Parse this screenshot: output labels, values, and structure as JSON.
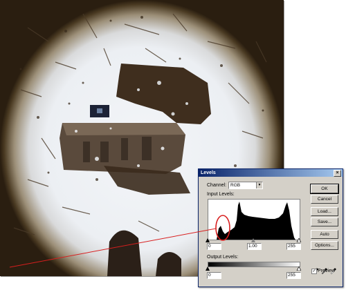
{
  "photo": {
    "description_icon": "snowy-ground-photo"
  },
  "dialog": {
    "title": "Levels",
    "close_glyph": "×",
    "channel_label": "Channel:",
    "channel_value": "RGB",
    "input_levels_label": "Input Levels:",
    "input_black": "0",
    "input_gamma": "1.00",
    "input_white": "255",
    "output_levels_label": "Output Levels:",
    "output_black": "0",
    "output_white": "255",
    "buttons": {
      "ok": "OK",
      "cancel": "Cancel",
      "load": "Load...",
      "save": "Save...",
      "auto": "Auto",
      "options": "Options..."
    },
    "preview_label": "Preview",
    "preview_checked": true,
    "check_glyph": "✓"
  },
  "colors": {
    "annotation": "#d81e1e",
    "titlebar": "#0a246a",
    "dialog_bg": "#d4d0c8"
  }
}
